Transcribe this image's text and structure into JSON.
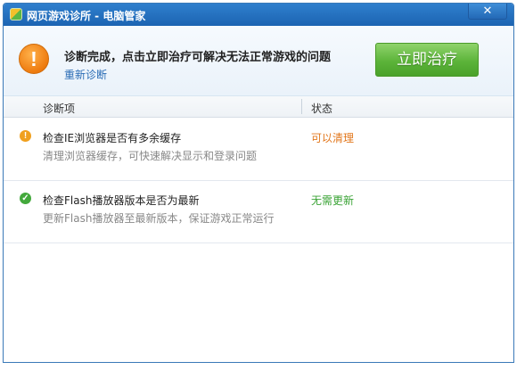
{
  "window": {
    "title": "网页游戏诊所 - 电脑管家",
    "close_label": "✕"
  },
  "header": {
    "warning_glyph": "!",
    "message": "诊断完成，点击立即治疗可解决无法正常游戏的问题",
    "rediagnose_link": "重新诊断",
    "fix_button": "立即治疗"
  },
  "table": {
    "columns": [
      "诊断项",
      "状态"
    ],
    "rows": [
      {
        "icon": "warning-icon",
        "icon_glyph": "!",
        "title": "检查IE浏览器是否有多余缓存",
        "description": "清理浏览器缓存，可快速解决显示和登录问题",
        "status": "可以清理",
        "status_color": "#e2771c"
      },
      {
        "icon": "check-icon",
        "icon_glyph": "✓",
        "title": "检查Flash播放器版本是否为最新",
        "description": "更新Flash播放器至最新版本，保证游戏正常运行",
        "status": "无需更新",
        "status_color": "#3aa335"
      }
    ]
  },
  "colors": {
    "titlebar": "#1f6ab8",
    "accent_green": "#5cb43a",
    "warning_orange": "#ee7b0f",
    "link_blue": "#2a6cb5"
  }
}
